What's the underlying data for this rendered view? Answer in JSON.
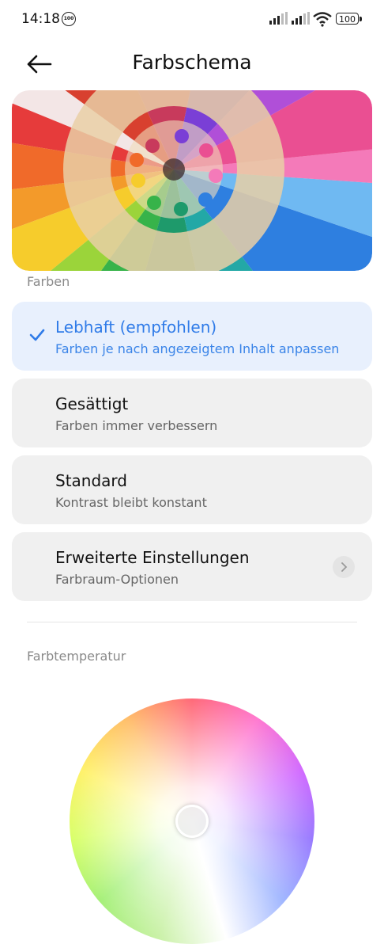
{
  "status": {
    "time": "14:18",
    "notif_badge": "100",
    "battery": "100"
  },
  "header": {
    "title": "Farbschema"
  },
  "sections": {
    "colors": "Farben",
    "temperature": "Farbtemperatur"
  },
  "options": [
    {
      "title": "Lebhaft (empfohlen)",
      "subtitle": "Farben je nach angezeigtem Inhalt anpassen",
      "selected": true
    },
    {
      "title": "Gesättigt",
      "subtitle": "Farben immer verbessern",
      "selected": false
    },
    {
      "title": "Standard",
      "subtitle": "Kontrast bleibt konstant",
      "selected": false
    },
    {
      "title": "Erweiterte Einstellungen",
      "subtitle": "Farbraum-Optionen",
      "selected": false
    }
  ],
  "accent_color": "#2f7be8",
  "icons": {
    "back": "arrow-left-icon",
    "check": "check-icon",
    "chevron": "chevron-right-icon"
  }
}
